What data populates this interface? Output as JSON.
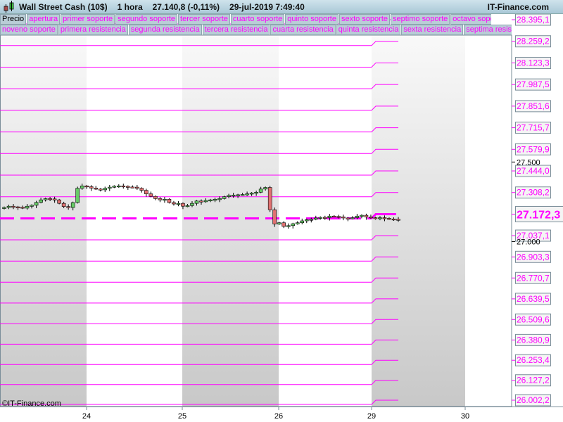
{
  "header": {
    "title": "Wall Street Cash (10$)",
    "timeframe": "1 hora",
    "last": "27.140,8 (-0,11%)",
    "datetime": "29-jul-2019 7:49:40",
    "brand": "IT-Finance.com"
  },
  "legend": {
    "row1": [
      "Precio",
      "apertura",
      "primer soporte",
      "segundo soporte",
      "tercer soporte",
      "cuarto soporte",
      "quinto soporte",
      "sexto soporte",
      "septimo soporte",
      "octavo soporte"
    ],
    "row2": [
      "noveno soporte",
      "primera resistencia",
      "segunda resistencia",
      "tercera resistencia",
      "cuarta resistencia",
      "quinta resistencia",
      "sexta resistencia",
      "septima resistencia"
    ]
  },
  "watermark": "©IT-Finance.com",
  "colors": {
    "level": "#ff00ff",
    "up": "#66cc66",
    "down": "#e07070"
  },
  "chart_data": {
    "type": "candlestick",
    "x_ticks": [
      "24",
      "25",
      "26",
      "29",
      "30"
    ],
    "y_range": [
      26002.2,
      28395.1
    ],
    "y_ticks": [
      {
        "value": 27500,
        "label": "27.500"
      },
      {
        "value": 27000,
        "label": "27.000"
      }
    ],
    "levels": [
      {
        "value": 28395.1,
        "label": "28.395,1"
      },
      {
        "value": 28259.2,
        "label": "28.259,2"
      },
      {
        "value": 28123.3,
        "label": "28.123,3"
      },
      {
        "value": 27987.5,
        "label": "27.987,5"
      },
      {
        "value": 27851.6,
        "label": "27.851,6"
      },
      {
        "value": 27715.7,
        "label": "27.715,7"
      },
      {
        "value": 27579.9,
        "label": "27.579,9"
      },
      {
        "value": 27444.0,
        "label": "27.444,0"
      },
      {
        "value": 27308.2,
        "label": "27.308,2"
      },
      {
        "value": 27172.3,
        "label": "27.172,3",
        "open": true
      },
      {
        "value": 27037.1,
        "label": "27.037,1"
      },
      {
        "value": 26903.3,
        "label": "26.903,3"
      },
      {
        "value": 26770.7,
        "label": "26.770,7"
      },
      {
        "value": 26639.5,
        "label": "26.639,5"
      },
      {
        "value": 26509.6,
        "label": "26.509,6"
      },
      {
        "value": 26380.9,
        "label": "26.380,9"
      },
      {
        "value": 26253.4,
        "label": "26.253,4"
      },
      {
        "value": 26127.2,
        "label": "26.127,2"
      },
      {
        "value": 26002.2,
        "label": "26.002,2"
      }
    ],
    "closes": [
      27214,
      27222,
      27218,
      27216,
      27210,
      27222,
      27228,
      27246,
      27262,
      27270,
      27268,
      27262,
      27240,
      27220,
      27214,
      27245,
      27335,
      27350,
      27345,
      27336,
      27330,
      27325,
      27335,
      27342,
      27348,
      27350,
      27347,
      27343,
      27342,
      27335,
      27322,
      27300,
      27284,
      27270,
      27262,
      27266,
      27245,
      27236,
      27240,
      27222,
      27226,
      27240,
      27255,
      27250,
      27258,
      27262,
      27266,
      27270,
      27282,
      27290,
      27292,
      27294,
      27296,
      27300,
      27305,
      27310,
      27330,
      27340,
      27200,
      27110,
      27118,
      27095,
      27100,
      27112,
      27118,
      27130,
      27138,
      27140,
      27148,
      27152,
      27150,
      27160,
      27158,
      27155,
      27148,
      27146,
      27150,
      27160,
      27165,
      27155,
      27150,
      27148,
      27150,
      27146,
      27142,
      27140,
      27138
    ]
  }
}
